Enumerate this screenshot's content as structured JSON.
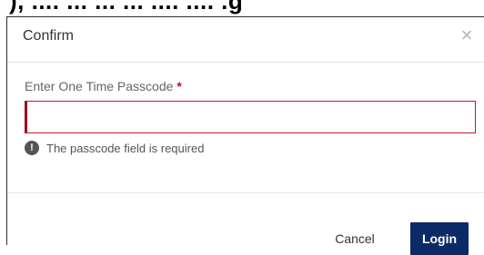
{
  "background": {
    "partial_text": "), .... ... ... ... .... .... .g"
  },
  "dialog": {
    "title": "Confirm",
    "close_symbol": "×",
    "field_label": "Enter One Time Passcode",
    "required_marker": "*",
    "input_value": "",
    "error_icon_glyph": "!",
    "error_message": "The passcode field is required",
    "cancel_label": "Cancel",
    "login_label": "Login"
  },
  "colors": {
    "login_button": "#0d2a68",
    "error_border": "#c01a2f",
    "required_marker": "#b3122b"
  },
  "icons": {
    "close": "close-icon",
    "error": "error-icon"
  }
}
